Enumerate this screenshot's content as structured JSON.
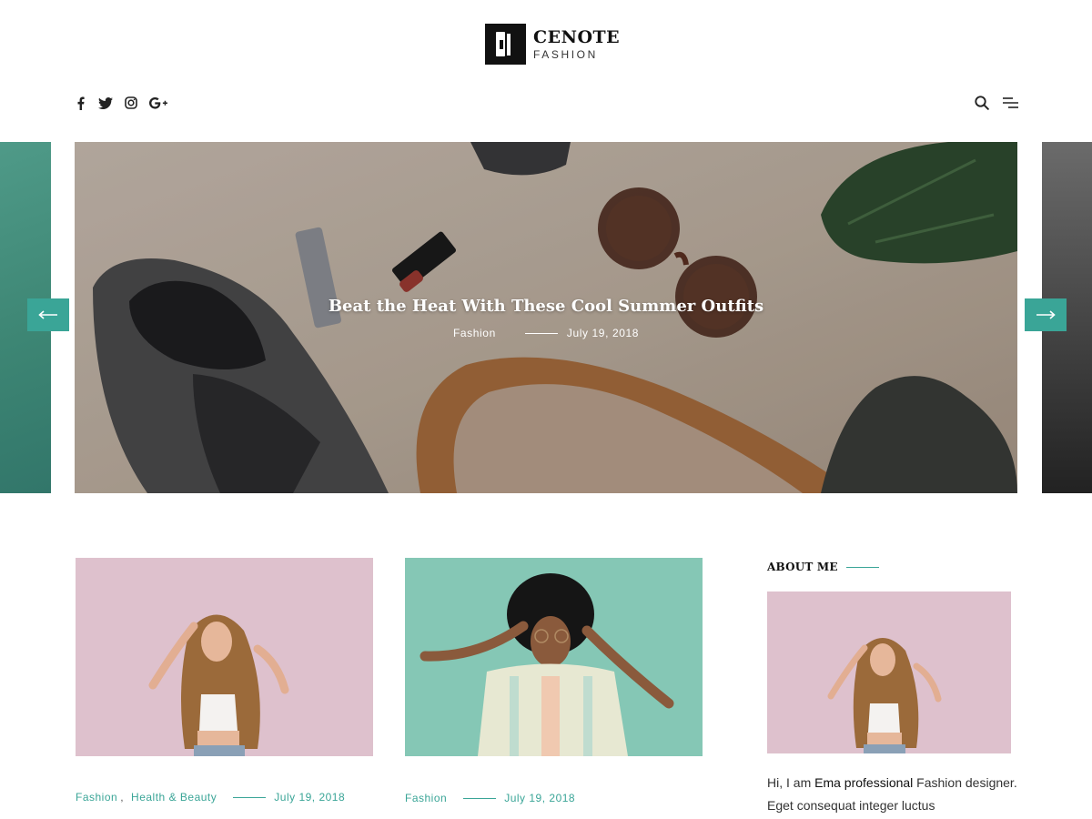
{
  "site": {
    "logo_title": "CENOTE",
    "logo_subtitle": "FASHION"
  },
  "social": [
    {
      "icon": "facebook-icon"
    },
    {
      "icon": "twitter-icon"
    },
    {
      "icon": "instagram-icon"
    },
    {
      "icon": "google-plus-icon"
    }
  ],
  "tools": [
    {
      "icon": "search-icon"
    },
    {
      "icon": "menu-icon"
    }
  ],
  "slider": {
    "title": "Beat the Heat With These Cool Summer Outfits",
    "category": "Fashion",
    "date": "July 19, 2018"
  },
  "posts": [
    {
      "categories": [
        "Fashion",
        "Health & Beauty"
      ],
      "separator": ",",
      "date": "July 19, 2018"
    },
    {
      "categories": [
        "Fashion"
      ],
      "date": "July 19, 2018"
    }
  ],
  "sidebar": {
    "about_title": "ABOUT ME",
    "about_text_1": "Hi, I am ",
    "about_text_2": "Ema professional",
    "about_text_3": " Fashion designer. Eget consequat integer luctus"
  },
  "colors": {
    "accent": "#3aa597",
    "text": "#333333",
    "heading": "#111111"
  }
}
